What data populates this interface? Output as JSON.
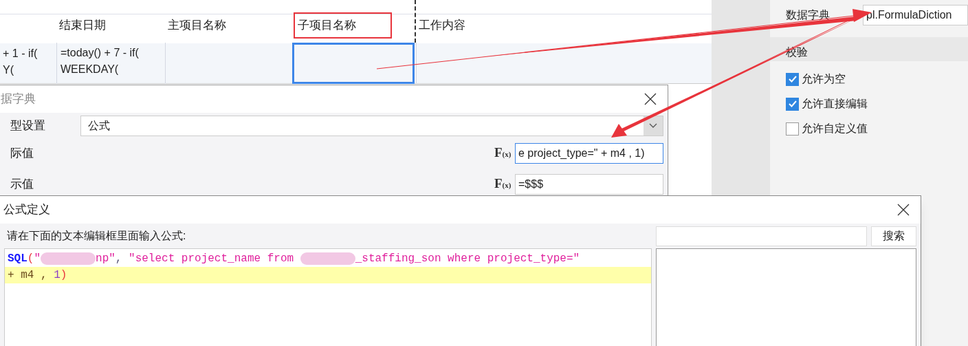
{
  "sheet": {
    "columns": [
      {
        "label": "结束日期",
        "annotated": false,
        "selected": false,
        "lines": [
          "=today() + 7 - if(",
          "WEEKDAY("
        ]
      },
      {
        "label": "主项目名称",
        "annotated": false,
        "selected": false
      },
      {
        "label": "子项目名称",
        "annotated": true,
        "selected": true
      },
      {
        "label": "工作内容",
        "annotated": false,
        "selected": false
      }
    ],
    "partial_cell": [
      "+ 1 - if(",
      "Y("
    ]
  },
  "properties": {
    "dictionary_label": "数据字典",
    "dictionary_value": "pl.FormulaDiction",
    "section": "校验",
    "checks": [
      {
        "label": "允许为空",
        "checked": true
      },
      {
        "label": "允许直接编辑",
        "checked": true
      },
      {
        "label": "允许自定义值",
        "checked": false
      }
    ]
  },
  "dictionary_dialog": {
    "title": "据字典",
    "type_label": "型设置",
    "type_value": "公式",
    "fields": [
      {
        "label": "际值",
        "value": "e project_type=\" + m4 , 1)",
        "focused": true,
        "formula_button": {
          "main": "F",
          "sub": "(x)"
        }
      },
      {
        "label": "示值",
        "value": "=$$$",
        "focused": false,
        "formula_button": {
          "main": "F",
          "sub": "(x)"
        }
      }
    ]
  },
  "formula_dialog": {
    "title": "公式定义",
    "prompt": "请在下面的文本编辑框里面输入公式:",
    "code_lines": [
      {
        "current": false,
        "tokens": [
          {
            "kind": "func",
            "text": "SQL"
          },
          {
            "kind": "paren",
            "text": "("
          },
          {
            "kind": "string",
            "text": "\""
          },
          {
            "kind": "redacted"
          },
          {
            "kind": "string",
            "text": "np\""
          },
          {
            "kind": "punct",
            "text": ", "
          },
          {
            "kind": "string",
            "text": "\"select project_name from "
          },
          {
            "kind": "redacted"
          },
          {
            "kind": "string",
            "text": "_staffing_son where project_type=\""
          }
        ]
      },
      {
        "current": true,
        "tokens": [
          {
            "kind": "plain",
            "text": "+ m4 , "
          },
          {
            "kind": "number",
            "text": "1"
          },
          {
            "kind": "paren",
            "text": ")"
          }
        ]
      }
    ],
    "search_button": "搜索"
  }
}
